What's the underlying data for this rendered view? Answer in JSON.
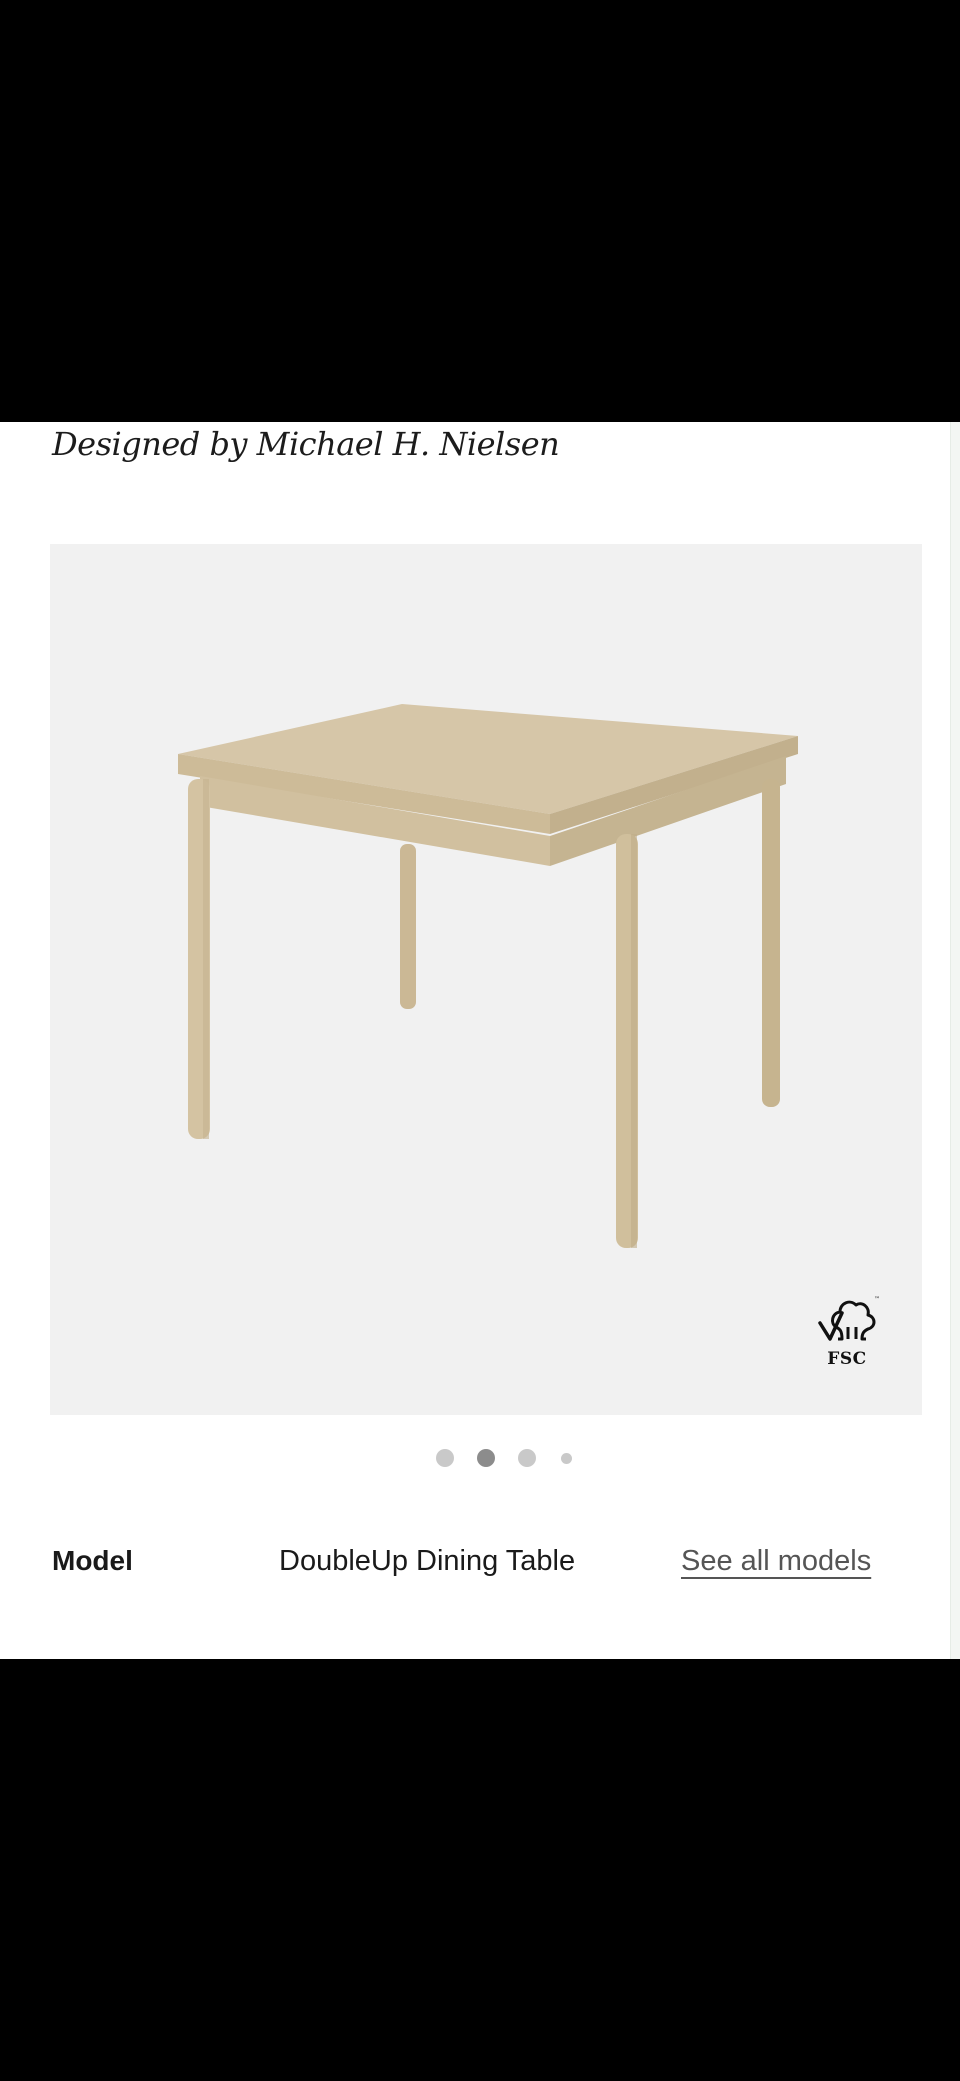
{
  "designer": {
    "text": "Designed by Michael H. Nielsen"
  },
  "gallery": {
    "image_subject": "Oak dining table",
    "badge": {
      "icon": "fsc-tree-checkmark-icon",
      "label": "FSC"
    },
    "slides_total": 4,
    "active_slide": 2
  },
  "model": {
    "label": "Model",
    "value": "DoubleUp Dining Table",
    "link_label": "See all models"
  },
  "colors": {
    "background": "#000000",
    "panel": "#ffffff",
    "gallery_bg": "#f1f1f1",
    "wood": "#d6c6a6",
    "dot_active": "#8c8c8c",
    "dot_inactive": "#c9c9c9"
  }
}
